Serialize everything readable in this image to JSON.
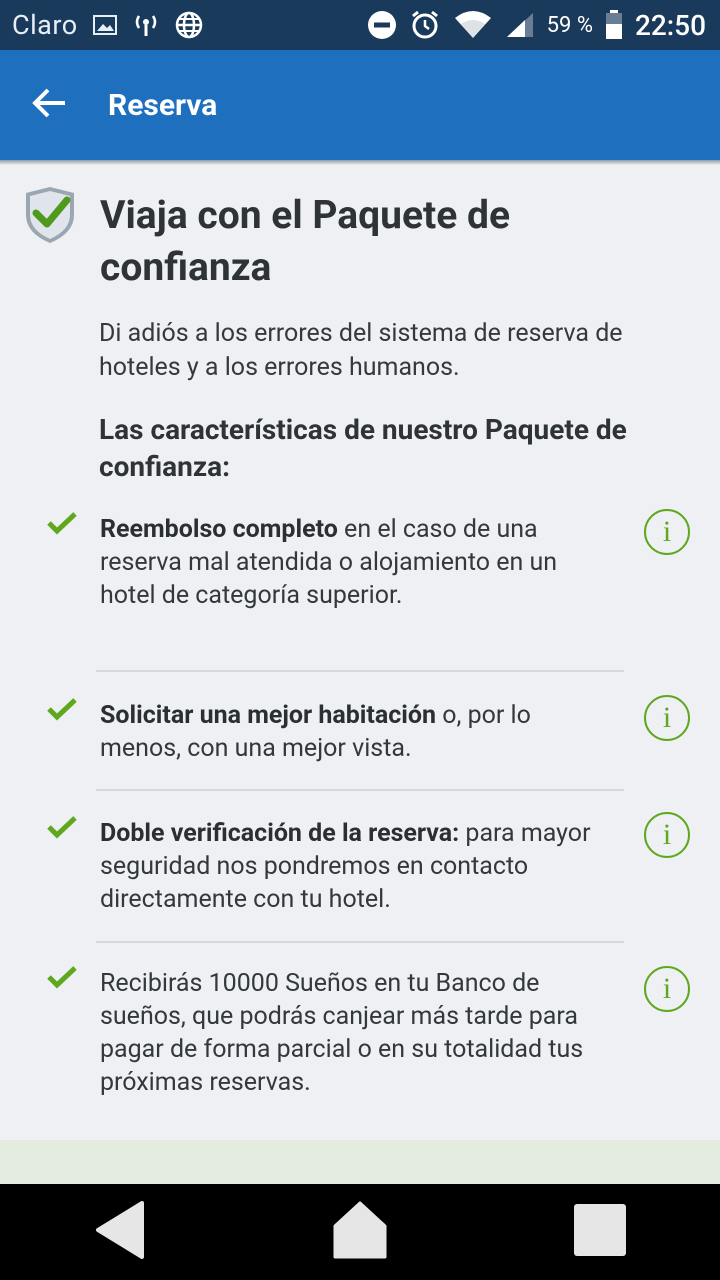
{
  "status_bar": {
    "carrier": "Claro",
    "battery_percent": "59 %",
    "time": "22:50",
    "icons": [
      "gallery-icon",
      "signal-tower-icon",
      "globe-icon",
      "dnd-icon",
      "alarm-icon",
      "wifi-icon",
      "cell-signal-icon",
      "battery-icon"
    ]
  },
  "app_bar": {
    "title": "Reserva",
    "back_icon": "arrow-left-icon",
    "color": "#1f6fbf"
  },
  "main": {
    "headline": "Viaja con el Paquete de confianza",
    "intro": "Di adiós a los errores del sistema de reserva de hoteles y a los errores humanos.",
    "features_heading": "Las características de nuestro Paquete de confianza:",
    "features": [
      {
        "bold": "Reembolso completo",
        "rest": " en el caso de una reserva mal atendida o alojamiento en un hotel de categoría superior."
      },
      {
        "bold": "Solicitar una mejor habitación",
        "rest": " o, por lo menos, con una mejor vista."
      },
      {
        "bold": "Doble verificación de la reserva:",
        "rest": " para mayor seguridad nos pondremos en contacto directamente con tu hotel."
      },
      {
        "bold": "",
        "rest": "Recibirás 10000 Sueños en tu Banco de sueños, que podrás canjear más tarde para pagar de forma parcial o en su totalidad tus próximas reservas."
      }
    ],
    "info_label": "i",
    "accent_green": "#5fa81e"
  },
  "nav_bar": {
    "buttons": [
      "back-triangle-icon",
      "home-icon",
      "recents-square-icon"
    ]
  }
}
